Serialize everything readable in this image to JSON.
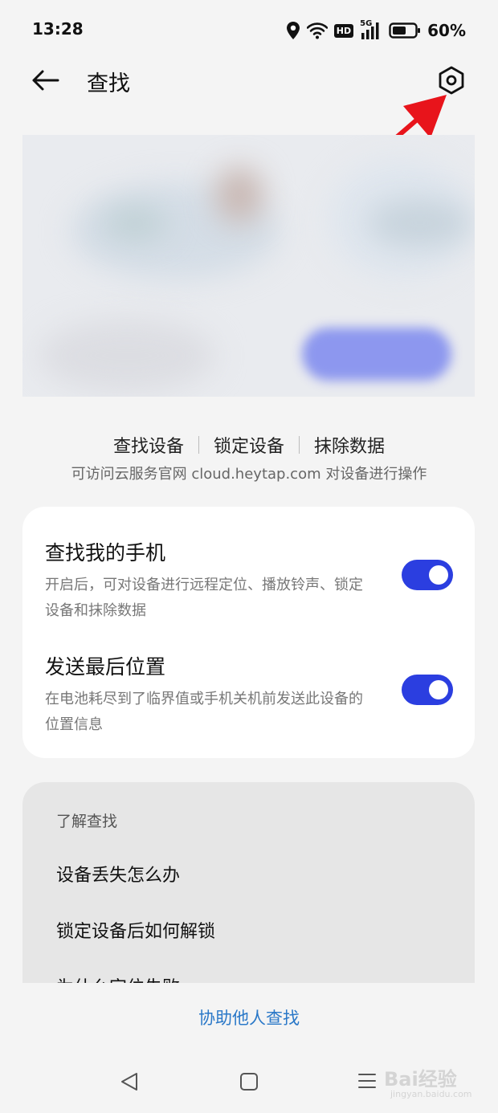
{
  "status_bar": {
    "time": "13:28",
    "hd_label": "HD",
    "network_label": "5G",
    "battery_percent": "60%",
    "battery_level": 0.6
  },
  "app_bar": {
    "title": "查找",
    "back_icon": "arrow-left-icon",
    "settings_icon": "settings-hexagon-icon"
  },
  "annotation": {
    "color": "#e8141b"
  },
  "feature_links": {
    "items": [
      "查找设备",
      "锁定设备",
      "抹除数据"
    ],
    "hint": "可访问云服务官网 cloud.heytap.com 对设备进行操作"
  },
  "settings": {
    "items": [
      {
        "title": "查找我的手机",
        "description": "开启后，可对设备进行远程定位、播放铃声、锁定设备和抹除数据",
        "enabled": true
      },
      {
        "title": "发送最后位置",
        "description": "在电池耗尽到了临界值或手机关机前发送此设备的位置信息",
        "enabled": true
      }
    ],
    "toggle_color": "#2b3ee0"
  },
  "faq": {
    "heading": "了解查找",
    "items": [
      "设备丢失怎么办",
      "锁定设备后如何解锁",
      "为什么定位失败"
    ]
  },
  "help_link": "协助他人查找",
  "nav_bar": {
    "back_icon": "triangle-back-icon",
    "home_icon": "square-home-icon",
    "menu_icon": "menu-lines-icon"
  },
  "watermark": {
    "text": "Bai经验",
    "sub": "jingyan.baidu.com"
  }
}
